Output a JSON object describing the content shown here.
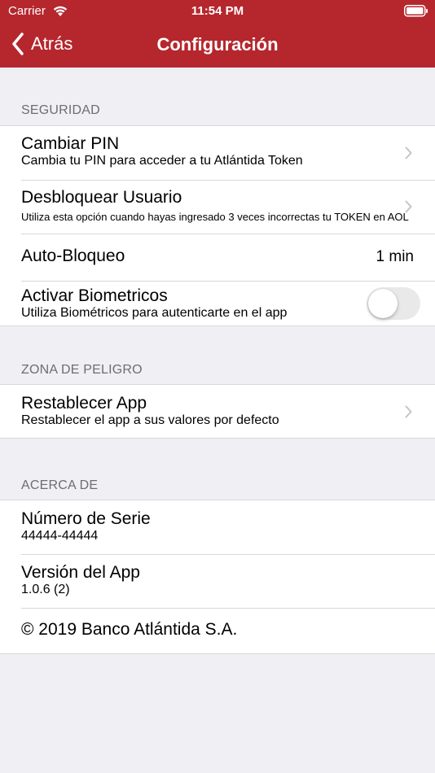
{
  "status_bar": {
    "carrier": "Carrier",
    "time": "11:54 PM"
  },
  "nav": {
    "back_label": "Atrás",
    "title": "Configuración",
    "color": "#b5272d"
  },
  "sections": {
    "security": {
      "header": "SEGURIDAD",
      "rows": [
        {
          "title": "Cambiar PIN",
          "subtitle": "Cambia tu PIN para acceder a tu Atlántida Token"
        },
        {
          "title": "Desbloquear Usuario",
          "subtitle": "Utiliza esta opción cuando hayas ingresado 3 veces incorrectas tu TOKEN en AOL"
        },
        {
          "title": "Auto-Bloqueo",
          "value": "1 min"
        },
        {
          "title": "Activar Biometricos",
          "subtitle": "Utiliza Biométricos para autenticarte en el app",
          "toggle_on": false
        }
      ]
    },
    "danger": {
      "header": "ZONA DE PELIGRO",
      "rows": [
        {
          "title": "Restablecer App",
          "subtitle": "Restablecer el app a sus valores por defecto"
        }
      ]
    },
    "about": {
      "header": "ACERCA DE",
      "rows": [
        {
          "title": "Número de Serie",
          "subtitle": "44444-44444"
        },
        {
          "title": "Versión del App",
          "subtitle": "1.0.6 (2)"
        },
        {
          "title": "© 2019 Banco Atlántida S.A."
        }
      ]
    }
  }
}
